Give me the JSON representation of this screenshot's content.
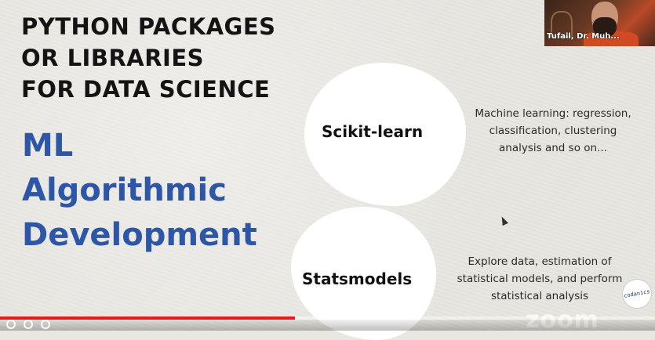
{
  "slide": {
    "title_lines": [
      "PYTHON PACKAGES",
      "OR LIBRARIES",
      "FOR DATA SCIENCE"
    ],
    "subtitle_lines": [
      "ML",
      "Algorithmic",
      "Development"
    ],
    "packages": [
      {
        "name": "Scikit-learn",
        "description_lines": [
          "Machine learning: regression,",
          "classification, clustering",
          "analysis and so on..."
        ]
      },
      {
        "name": "Statsmodels",
        "description_lines": [
          "Explore data, estimation of",
          "statistical models, and perform",
          "statistical analysis"
        ]
      }
    ]
  },
  "participant": {
    "name": "Tufail, Dr. Muh..."
  },
  "logo": {
    "text": "codanics"
  },
  "player": {
    "progress_percent": 45,
    "watermark": "zoom",
    "progress_color": "#e21b1b"
  },
  "colors": {
    "subtitle": "#2d56a7",
    "background": "#e7e5df"
  }
}
